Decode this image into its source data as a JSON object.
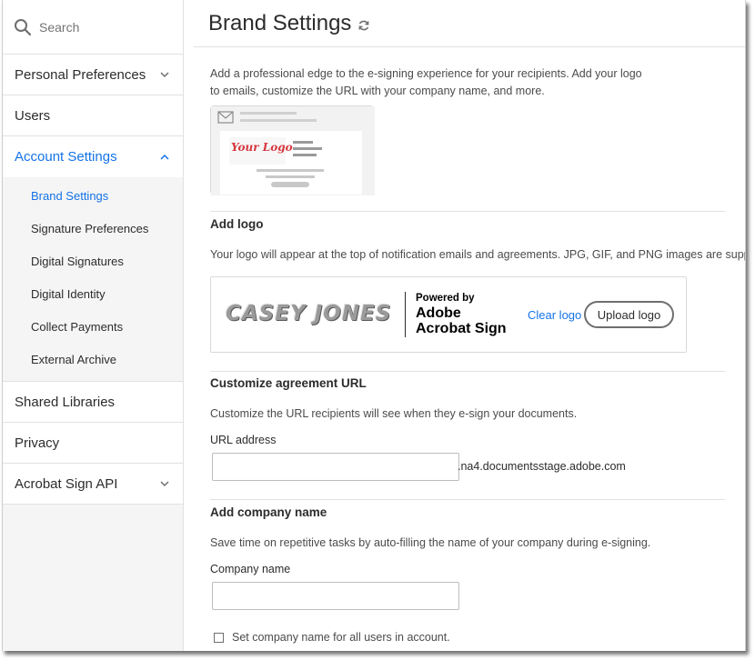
{
  "sidebar": {
    "search_placeholder": "Search",
    "items": [
      {
        "label": "Personal Preferences",
        "icon": "chevron-down-icon"
      },
      {
        "label": "Users"
      },
      {
        "label": "Account Settings",
        "icon": "chevron-up-icon",
        "active": true
      },
      {
        "label": "Shared Libraries"
      },
      {
        "label": "Privacy"
      },
      {
        "label": "Acrobat Sign API",
        "icon": "chevron-down-icon"
      }
    ],
    "sub_items": [
      {
        "label": "Brand Settings",
        "active": true
      },
      {
        "label": "Signature Preferences"
      },
      {
        "label": "Digital Signatures"
      },
      {
        "label": "Digital Identity"
      },
      {
        "label": "Collect Payments"
      },
      {
        "label": "External Archive"
      }
    ]
  },
  "page": {
    "title": "Brand Settings",
    "intro": "Add a professional edge to the e-signing experience for your recipients. Add your logo to emails, customize the URL with your company name, and more.",
    "illustration_logo_text": "Your Logo"
  },
  "logo_section": {
    "title": "Add logo",
    "desc": "Your logo will appear at the top of notification emails and agreements. JPG, GIF, and PNG images are supported.",
    "logo_text": "CASEY JONES",
    "powered_by": "Powered by",
    "brand_line1": "Adobe",
    "brand_line2": "Acrobat Sign",
    "clear_label": "Clear logo",
    "upload_label": "Upload logo"
  },
  "url_section": {
    "title": "Customize agreement URL",
    "desc": "Customize the URL recipients will see when they e-sign your documents.",
    "field_label": "URL address",
    "value": "",
    "suffix": ".na4.documentsstage.adobe.com"
  },
  "company_section": {
    "title": "Add company name",
    "desc": "Save time on repetitive tasks by auto-filling the name of your company during e-signing.",
    "field_label": "Company name",
    "value": "",
    "checkbox_label": "Set company name for all users in account.",
    "checkbox_checked": false
  },
  "colors": {
    "accent": "#1473e6",
    "sidebar_bg": "#f5f5f5",
    "logo_script_red": "#d7373f"
  }
}
